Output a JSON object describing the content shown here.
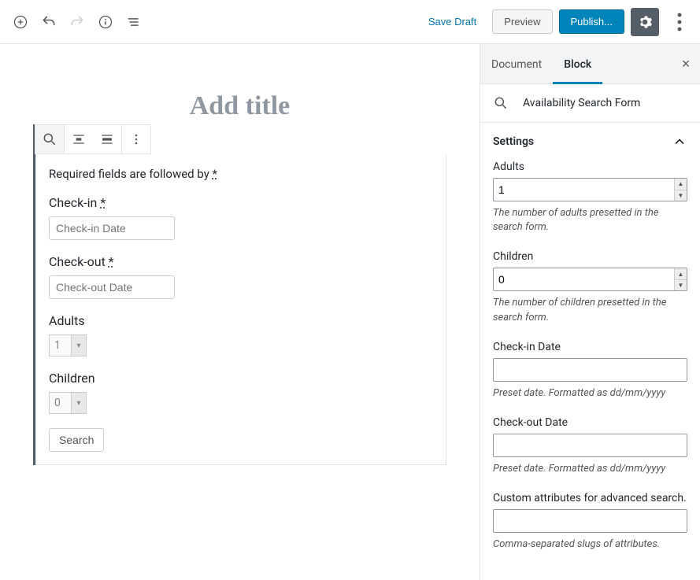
{
  "topbar": {
    "saveDraft": "Save Draft",
    "preview": "Preview",
    "publish": "Publish..."
  },
  "editor": {
    "titlePlaceholder": "Add title",
    "requiredNote": "Required fields are followed by ",
    "asterisk": "*",
    "checkIn": {
      "label": "Check-in ",
      "placeholder": "Check-in Date"
    },
    "checkOut": {
      "label": "Check-out ",
      "placeholder": "Check-out Date"
    },
    "adults": {
      "label": "Adults",
      "value": "1"
    },
    "children": {
      "label": "Children",
      "value": "0"
    },
    "searchBtn": "Search"
  },
  "sidebar": {
    "tabs": {
      "document": "Document",
      "block": "Block"
    },
    "blockTitle": "Availability Search Form",
    "settingsHeader": "Settings",
    "adults": {
      "label": "Adults",
      "value": "1",
      "help": "The number of adults presetted in the search form."
    },
    "children": {
      "label": "Children",
      "value": "0",
      "help": "The number of children presetted in the search form."
    },
    "checkIn": {
      "label": "Check-in Date",
      "value": "",
      "help": "Preset date. Formatted as dd/mm/yyyy"
    },
    "checkOut": {
      "label": "Check-out Date",
      "value": "",
      "help": "Preset date. Formatted as dd/mm/yyyy"
    },
    "customAttr": {
      "label": "Custom attributes for advanced search.",
      "value": "",
      "help": "Comma-separated slugs of attributes."
    }
  }
}
